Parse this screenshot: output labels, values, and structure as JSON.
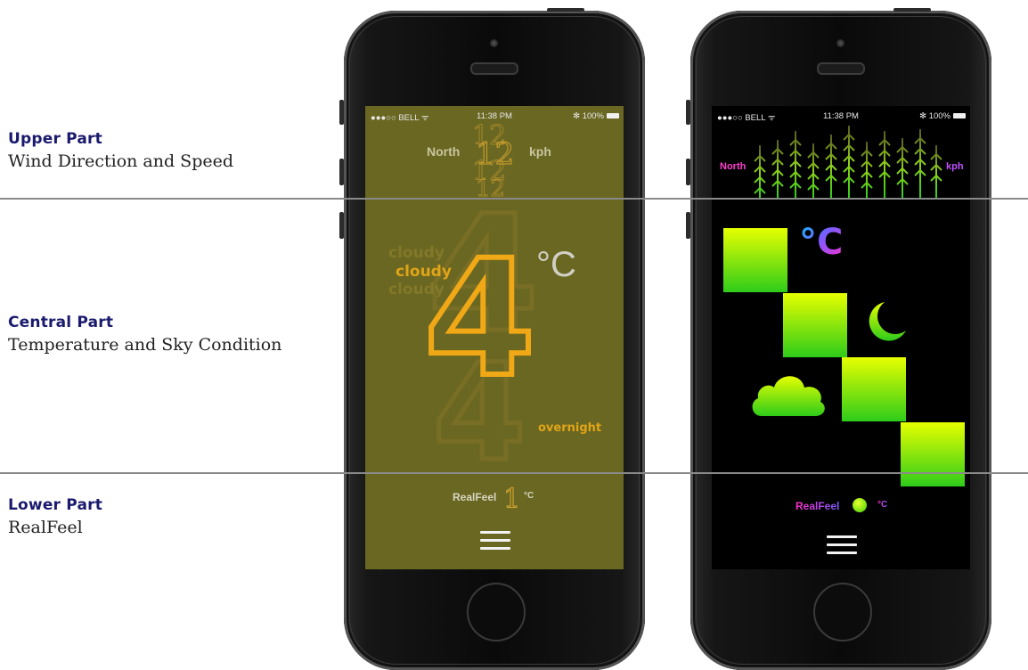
{
  "annotations": {
    "upper": {
      "title": "Upper Part",
      "subtitle": "Wind Direction and Speed"
    },
    "central": {
      "title": "Central Part",
      "subtitle": "Temperature and Sky Condition"
    },
    "lower": {
      "title": "Lower Part",
      "subtitle": "RealFeel"
    }
  },
  "status_bar": {
    "carrier": "●●●○○ BELL ᯤ",
    "time": "11:38 PM",
    "battery": "✻ 100%"
  },
  "phone1": {
    "wind_direction": "North",
    "wind_speed": "12",
    "wind_unit": "kph",
    "temperature": "4",
    "temp_unit": "°C",
    "condition": "cloudy",
    "period": "overnight",
    "realfeel_label": "RealFeel",
    "realfeel_value": "1",
    "realfeel_unit": "°C"
  },
  "phone2": {
    "wind_direction": "North",
    "wind_unit": "kph",
    "temp_unit": "°C",
    "realfeel_label": "RealFeel",
    "realfeel_unit": "°C"
  },
  "colors": {
    "screen1_bg": "#6a6722",
    "accent_orange": "#f0a816",
    "green_top": "#e6ff00",
    "green_bottom": "#2ecc1a",
    "pink": "#ff2ecb",
    "divider": "#8a8a8a"
  },
  "icons": [
    "wifi-icon",
    "bluetooth-icon",
    "battery-icon",
    "menu-icon",
    "cloud-icon",
    "moon-icon",
    "wind-arrows-icon"
  ]
}
